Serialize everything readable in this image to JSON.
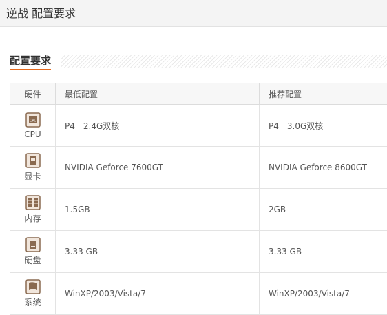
{
  "header": {
    "title": "逆战 配置要求"
  },
  "section": {
    "title": "配置要求"
  },
  "table": {
    "headers": {
      "hardware": "硬件",
      "minimum": "最低配置",
      "recommended": "推荐配置"
    },
    "rows": [
      {
        "icon": "cpu-icon",
        "name": "CPU",
        "minimum": "P4　2.4G双核",
        "recommended": "P4　3.0G双核"
      },
      {
        "icon": "graphics-card-icon",
        "name": "显卡",
        "minimum": "NVIDIA Geforce 7600GT",
        "recommended": "NVIDIA Geforce 8600GT"
      },
      {
        "icon": "memory-icon",
        "name": "内存",
        "minimum": "1.5GB",
        "recommended": "2GB"
      },
      {
        "icon": "hard-disk-icon",
        "name": "硬盘",
        "minimum": "3.33 GB",
        "recommended": "3.33 GB"
      },
      {
        "icon": "os-flag-icon",
        "name": "系统",
        "minimum": "WinXP/2003/Vista/7",
        "recommended": "WinXP/2003/Vista/7"
      }
    ]
  },
  "colors": {
    "accent": "#e46a1e",
    "icon_brown": "#8a6a50",
    "header_bg": "#f4f4f4"
  }
}
